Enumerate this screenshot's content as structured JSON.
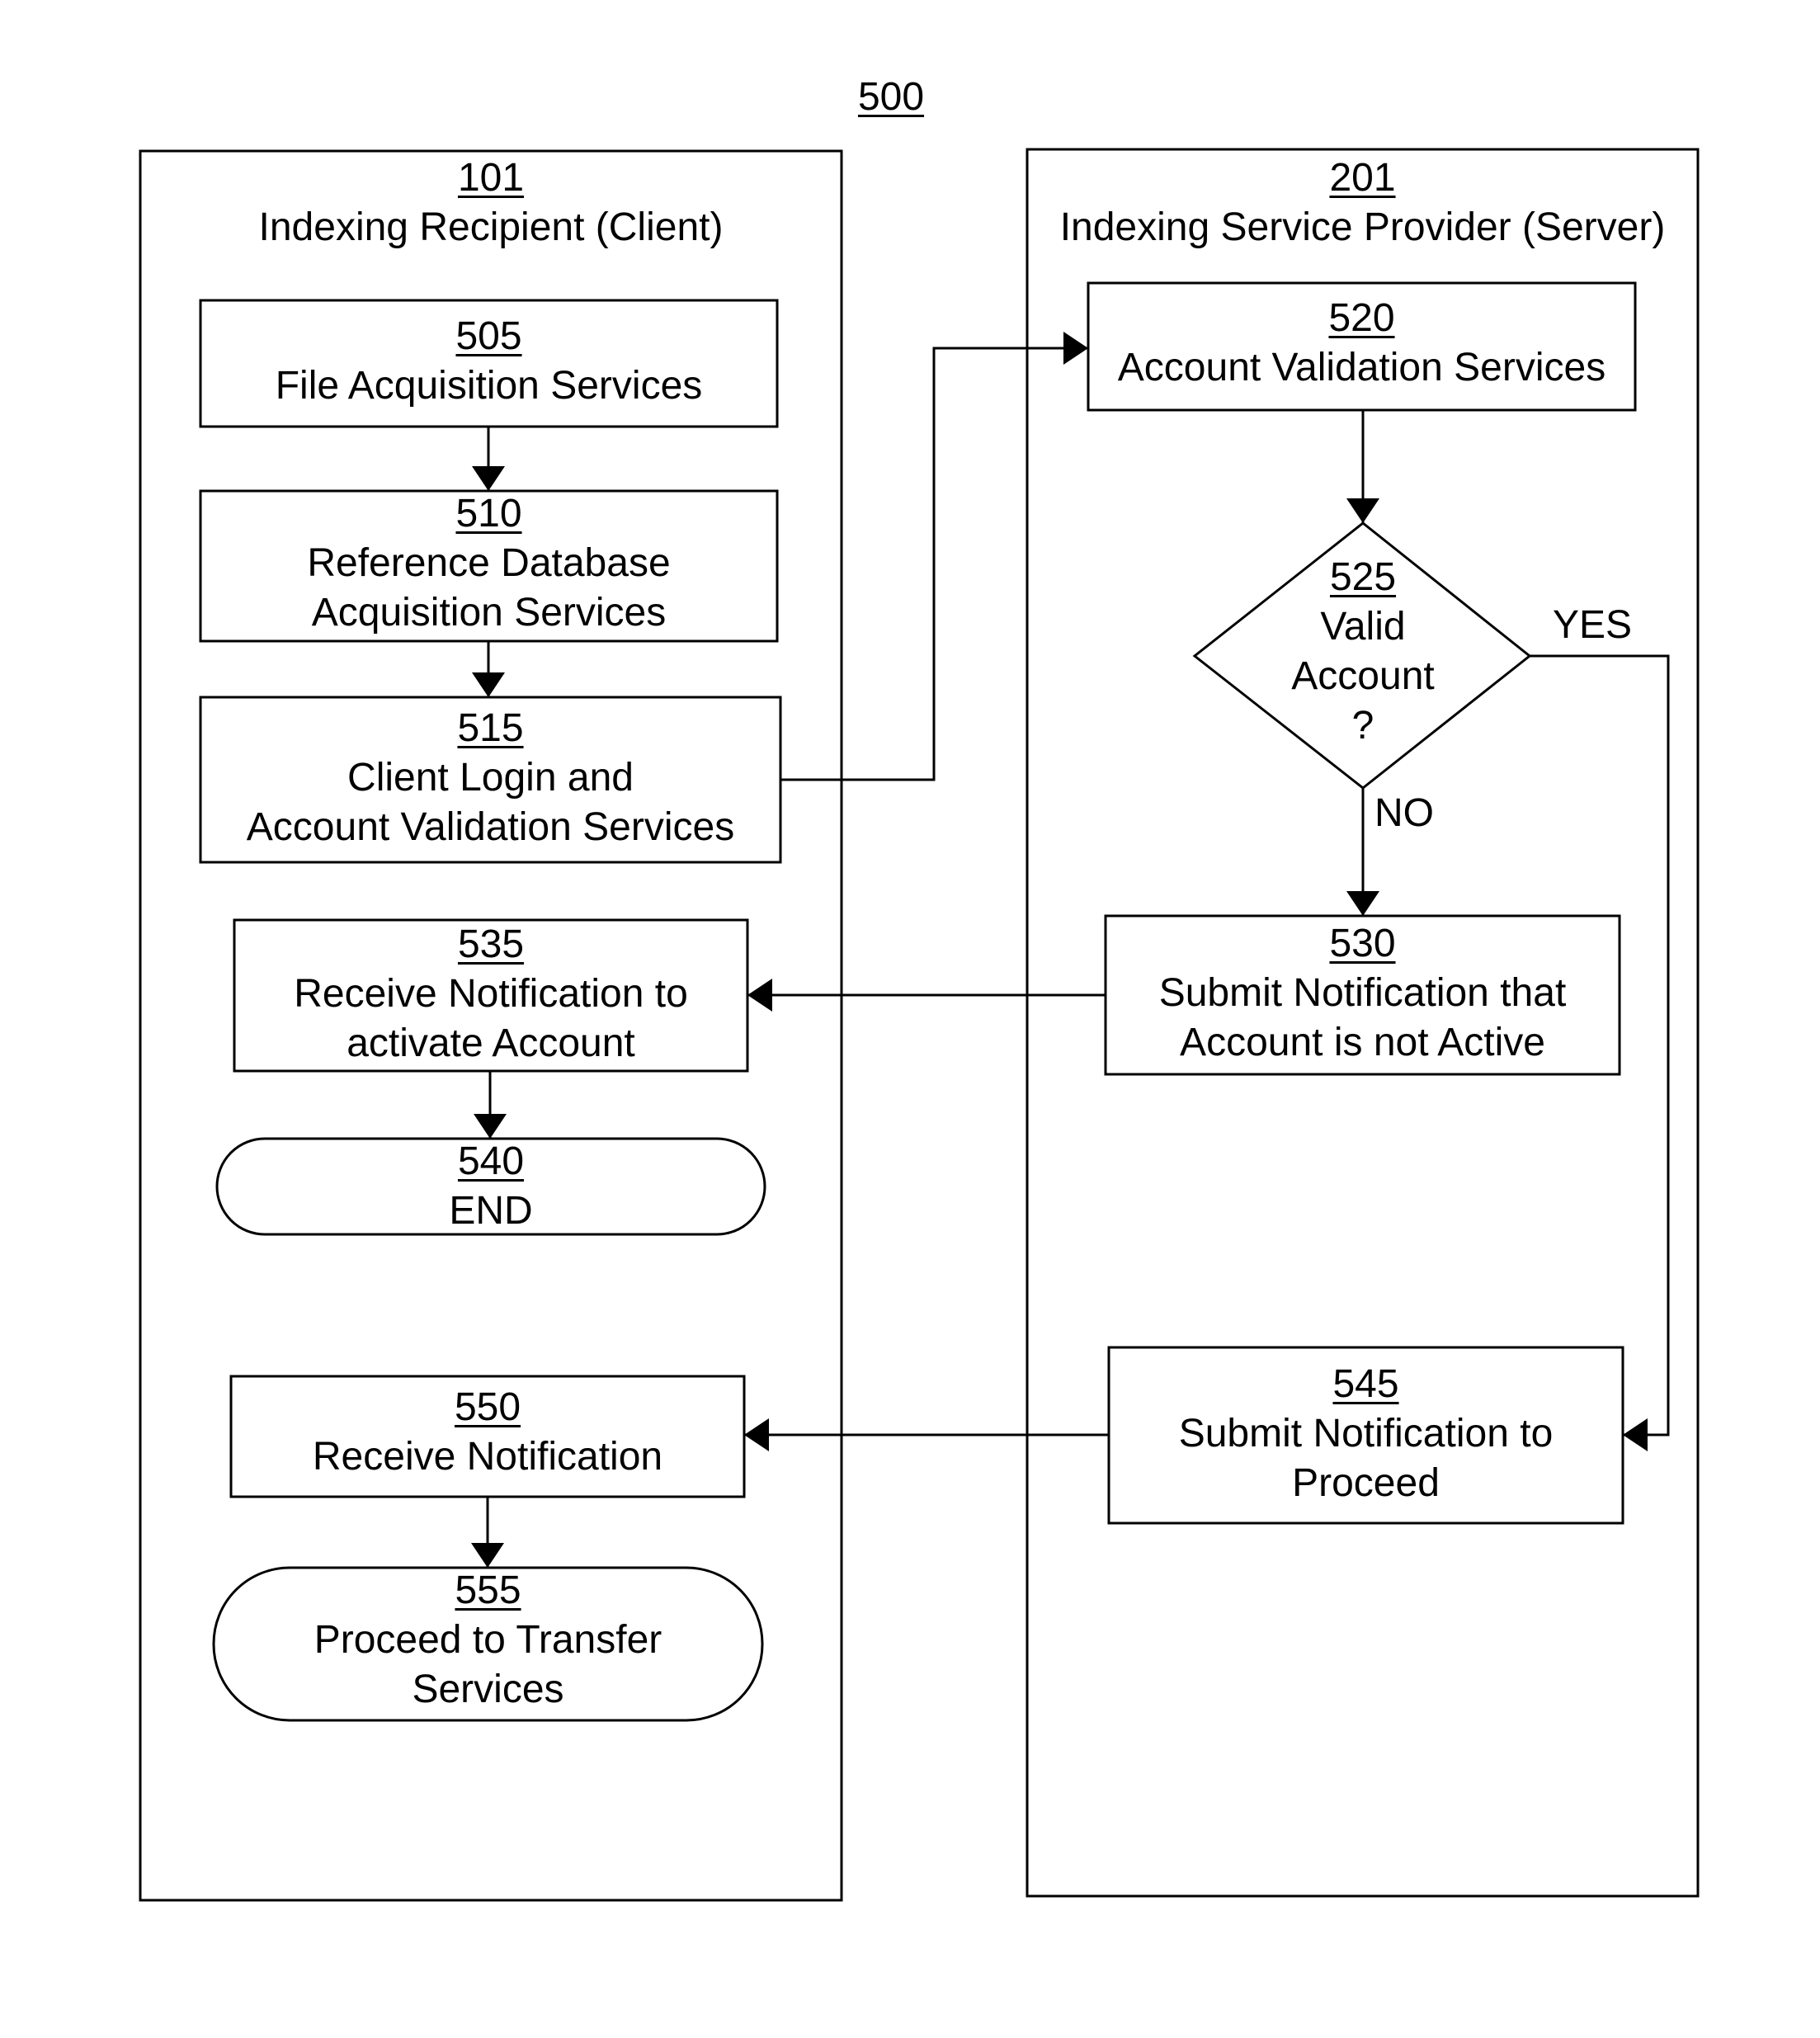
{
  "figure": {
    "number": "500"
  },
  "lanes": [
    {
      "id": "101",
      "title": "Indexing Recipient (Client)"
    },
    {
      "id": "201",
      "title": "Indexing Service Provider (Server)"
    }
  ],
  "steps": {
    "s505": {
      "id": "505",
      "text": "File Acquisition Services",
      "shape": "process"
    },
    "s510": {
      "id": "510",
      "text": "Reference Database\nAcquisition Services",
      "shape": "process"
    },
    "s515": {
      "id": "515",
      "text": "Client Login and\nAccount Validation Services",
      "shape": "process"
    },
    "s520": {
      "id": "520",
      "text": "Account Validation Services",
      "shape": "process"
    },
    "s525": {
      "id": "525",
      "text": "Valid\nAccount\n?",
      "shape": "decision"
    },
    "s530": {
      "id": "530",
      "text": "Submit Notification that\nAccount is not Active",
      "shape": "process"
    },
    "s535": {
      "id": "535",
      "text": "Receive Notification to\nactivate Account",
      "shape": "process"
    },
    "s540": {
      "id": "540",
      "text": "END",
      "shape": "terminator"
    },
    "s545": {
      "id": "545",
      "text": "Submit Notification to\nProceed",
      "shape": "process"
    },
    "s550": {
      "id": "550",
      "text": "Receive Notification",
      "shape": "process"
    },
    "s555": {
      "id": "555",
      "text": "Proceed to Transfer\nServices",
      "shape": "terminator"
    }
  },
  "branch_labels": {
    "yes": "YES",
    "no": "NO"
  },
  "edges": [
    {
      "from": "505",
      "to": "510"
    },
    {
      "from": "510",
      "to": "515"
    },
    {
      "from": "515",
      "to": "520"
    },
    {
      "from": "520",
      "to": "525"
    },
    {
      "from": "525",
      "to": "530",
      "label": "NO"
    },
    {
      "from": "525",
      "to": "545",
      "label": "YES"
    },
    {
      "from": "530",
      "to": "535"
    },
    {
      "from": "535",
      "to": "540"
    },
    {
      "from": "545",
      "to": "550"
    },
    {
      "from": "550",
      "to": "555"
    }
  ]
}
